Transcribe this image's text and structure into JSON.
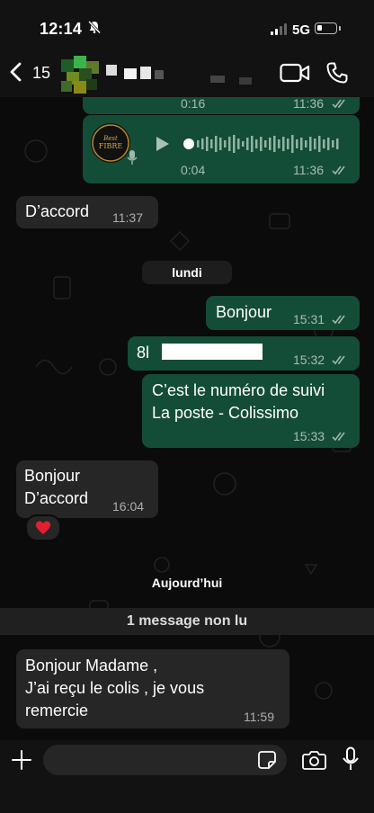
{
  "status_bar": {
    "time": "12:14",
    "network": "5G",
    "icons": [
      "muted-bell-icon",
      "signal-icon",
      "battery-icon"
    ]
  },
  "header": {
    "back_count": "15",
    "icons": [
      "chevron-left-icon",
      "video-call-icon",
      "phone-icon"
    ]
  },
  "messages": [
    {
      "direction": "outgoing",
      "type": "voice",
      "duration": "0:16",
      "time": "11:36",
      "status": "read"
    },
    {
      "direction": "outgoing",
      "type": "voice",
      "duration": "0:04",
      "time": "11:36",
      "status": "read"
    },
    {
      "direction": "incoming",
      "text": "D’accord",
      "time": "11:37"
    },
    {
      "type": "day",
      "label": "lundi"
    },
    {
      "direction": "outgoing",
      "text": "Bonjour",
      "time": "15:31",
      "status": "read"
    },
    {
      "direction": "outgoing",
      "text": "8l",
      "time": "15:32",
      "status": "read",
      "redacted": true
    },
    {
      "direction": "outgoing",
      "text": "C’est le numéro de suivi\nLa poste - Colissimo",
      "time": "15:33",
      "status": "read"
    },
    {
      "direction": "incoming",
      "text": "Bonjour\nD’accord",
      "time": "16:04",
      "reaction": "❤️"
    },
    {
      "type": "day",
      "label": "Aujourd’hui"
    },
    {
      "type": "unread",
      "label": "1 message non lu"
    },
    {
      "direction": "incoming",
      "text": "Bonjour Madame ,\nJ’ai reçu le colis , je vous\nremercie",
      "time": "11:59"
    }
  ],
  "input": {
    "placeholder": "",
    "icons": [
      "plus-icon",
      "sticker-icon",
      "camera-icon",
      "microphone-icon"
    ]
  },
  "colors": {
    "outgoing_bubble": "#144d37",
    "incoming_bubble": "#262626",
    "background": "#0b0b0b",
    "bars": "#121212"
  }
}
